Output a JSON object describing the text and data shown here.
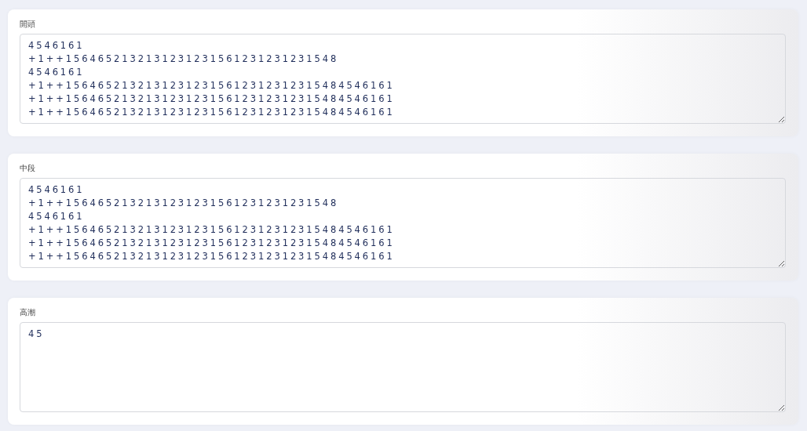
{
  "sections": [
    {
      "label": "開頭",
      "value": "4546161\n+1++1564652132131231231561231231231548\n4546161\n+1++15646521321312312315612312312315484546161\n+1++15646521321312312315612312312315484546161\n+1++15646521321312312315612312312315484546161"
    },
    {
      "label": "中段",
      "value": "4546161\n+1++1564652132131231231561231231231548\n4546161\n+1++15646521321312312315612312312315484546161\n+1++15646521321312312315612312312315484546161\n+1++15646521321312312315612312312315484546161"
    },
    {
      "label": "高潮",
      "value": "45"
    }
  ]
}
